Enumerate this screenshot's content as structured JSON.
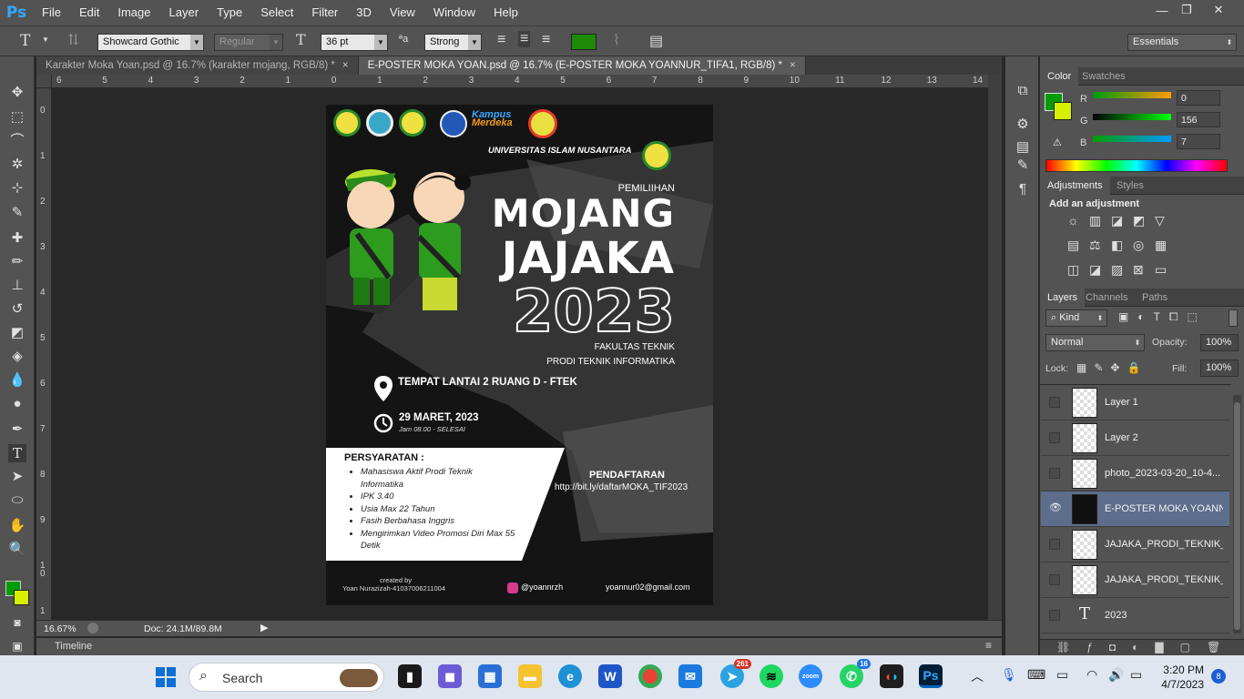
{
  "app": {
    "logo": "Ps",
    "name": "Photoshop"
  },
  "menu": [
    "File",
    "Edit",
    "Image",
    "Layer",
    "Type",
    "Select",
    "Filter",
    "3D",
    "View",
    "Window",
    "Help"
  ],
  "window_controls": {
    "minimize": "—",
    "restore": "❐",
    "close": "✕"
  },
  "options": {
    "tool_glyph": "T",
    "font_family": "Showcard Gothic",
    "font_style": "Regular",
    "font_size": "36 pt",
    "aa_label": "ªa",
    "antialias": "Strong",
    "text_color": "#1e8a0a",
    "workspace": "Essentials"
  },
  "tabs": [
    {
      "label": "Karakter Moka Yoan.psd @ 16.7% (karakter mojang, RGB/8) *",
      "close": "×"
    },
    {
      "label": "E-POSTER MOKA YOAN.psd @ 16.7% (E-POSTER MOKA YOANNUR_TIFA1, RGB/8) *",
      "close": "×"
    }
  ],
  "ruler_top": [
    "6",
    "5",
    "4",
    "3",
    "2",
    "1",
    "0",
    "1",
    "2",
    "3",
    "4",
    "5",
    "6",
    "7",
    "8",
    "9",
    "10",
    "11",
    "12",
    "13",
    "14"
  ],
  "ruler_left": [
    "0",
    "1",
    "2",
    "3",
    "4",
    "5",
    "6",
    "7",
    "8",
    "9",
    "1\n0",
    "1"
  ],
  "status": {
    "zoom": "16.67%",
    "doc": "Doc: 24.1M/89.8M",
    "timeline": "Timeline"
  },
  "poster": {
    "university": "UNIVERSITAS ISLAM NUSANTARA",
    "kampus_logo_line1": "Kampus",
    "kampus_logo_line2": "Merdeka",
    "pemilihan": "PEMILIIHAN",
    "title1": "MOJANG",
    "title2": "JAJAKA",
    "year": "2023",
    "faculty": "FAKULTAS TEKNIK",
    "prodi": "PRODI TEKNIK INFORMATIKA",
    "place": "TEMPAT LANTAI 2 RUANG D - FTEK",
    "date": "29 MARET, 2023",
    "time": "Jam 08.00 - SELESAI",
    "req_title": "PERSYARATAN :",
    "requirements": [
      "Mahasiswa Aktif Prodi Teknik Informatika",
      "IPK 3.40",
      "Usia Max 22 Tahun",
      "Fasih Berbahasa Inggris",
      "Mengirimkan Video Promosi Diri Max 55 Detik"
    ],
    "register_title": "PENDAFTARAN",
    "register_link": "http://bit.ly/daftarMOKA_TIF2023",
    "created_by": "created by",
    "author": "Yoan Nurazizah-41037006211004",
    "instagram": "@yoannrzh",
    "email": "yoannur02@gmail.com",
    "colors": {
      "bg": "#141414",
      "accent_green": "#3aa31a",
      "yellow": "#e8e040"
    }
  },
  "color_panel": {
    "tabs": [
      "Color",
      "Swatches"
    ],
    "r_label": "R",
    "g_label": "G",
    "b_label": "B",
    "r": "0",
    "g": "156",
    "b": "7",
    "fg_color": "#009c07",
    "bg_color": "#d6f000"
  },
  "adjustments": {
    "tabs": [
      "Adjustments",
      "Styles"
    ],
    "hint": "Add an adjustment"
  },
  "layers_panel": {
    "tabs": [
      "Layers",
      "Channels",
      "Paths"
    ],
    "filter": "Kind",
    "blend_mode": "Normal",
    "opacity_label": "Opacity:",
    "opacity": "100%",
    "lock_label": "Lock:",
    "fill_label": "Fill:",
    "fill": "100%",
    "layers": [
      {
        "name": "Layer 1",
        "visible": false,
        "selected": false
      },
      {
        "name": "Layer 2",
        "visible": false,
        "selected": false
      },
      {
        "name": "photo_2023-03-20_10-4...",
        "visible": false,
        "selected": false
      },
      {
        "name": "E-POSTER MOKA YOANN...",
        "visible": true,
        "selected": true
      },
      {
        "name": "JAJAKA_PRODI_TEKNIK_...",
        "visible": false,
        "selected": false
      },
      {
        "name": "JAJAKA_PRODI_TEKNIK_...",
        "visible": false,
        "selected": false
      },
      {
        "name": "2023",
        "visible": false,
        "selected": false
      }
    ],
    "type_layer_glyph": "T"
  },
  "taskbar": {
    "search": "Search",
    "time": "3:20 PM",
    "date": "4/7/2023",
    "notif_count": "8",
    "telegram_badge": "261",
    "whatsapp_badge": "16",
    "zoom_label": "zoom",
    "ps_label": "Ps"
  }
}
